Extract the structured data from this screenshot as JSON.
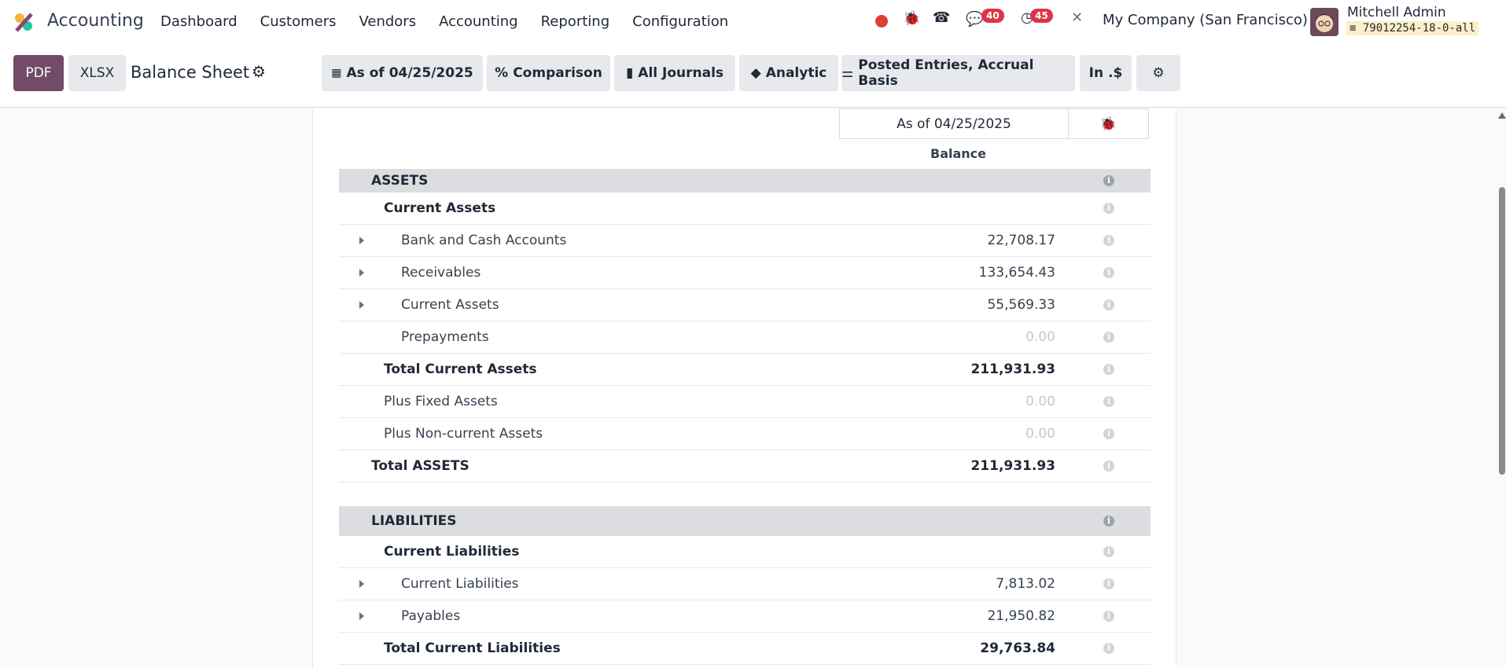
{
  "nav": {
    "app": "Accounting",
    "menu": [
      "Dashboard",
      "Customers",
      "Vendors",
      "Accounting",
      "Reporting",
      "Configuration"
    ],
    "messages_count": "40",
    "activities_count": "45",
    "company": "My Company (San Francisco)",
    "user": "Mitchell Admin",
    "database": "79012254-18-0-all"
  },
  "toolbar": {
    "pdf": "PDF",
    "xlsx": "XLSX",
    "title": "Balance Sheet",
    "filters": [
      {
        "icon": "calendar-icon",
        "glyph": "📅",
        "label": "As of 04/25/2025"
      },
      {
        "icon": "percent-icon",
        "glyph": "%",
        "label": "Comparison"
      },
      {
        "icon": "book-icon",
        "glyph": "▮",
        "label": "All Journals"
      },
      {
        "icon": "layers-icon",
        "glyph": "◆",
        "label": "Analytic"
      },
      {
        "icon": "sliders-icon",
        "glyph": "⚌",
        "label": "Posted Entries, Accrual Basis"
      },
      {
        "icon": "",
        "glyph": "",
        "label": "In .$"
      },
      {
        "icon": "gears-icon",
        "glyph": "⚙",
        "label": ""
      }
    ]
  },
  "report": {
    "column_header": "As of 04/25/2025",
    "column_label": "Balance",
    "rows": [
      {
        "type": "sec",
        "label": "ASSETS",
        "level": 0
      },
      {
        "type": "bold",
        "label": "Current Assets",
        "level": 1,
        "value": ""
      },
      {
        "label": "Bank and Cash Accounts",
        "level": 2,
        "value": "22,708.17",
        "expand": true
      },
      {
        "label": "Receivables",
        "level": 2,
        "value": "133,654.43",
        "expand": true
      },
      {
        "label": "Current Assets",
        "level": 2,
        "value": "55,569.33",
        "expand": true
      },
      {
        "label": "Prepayments",
        "level": 2,
        "value": "0.00",
        "muted": true
      },
      {
        "type": "bold",
        "label": "Total Current Assets",
        "level": 1,
        "value": "211,931.93"
      },
      {
        "label": "Plus Fixed Assets",
        "level": 1,
        "value": "0.00",
        "muted": true
      },
      {
        "label": "Plus Non-current Assets",
        "level": 1,
        "value": "0.00",
        "muted": true
      },
      {
        "type": "bold",
        "label": "Total ASSETS",
        "level": 0,
        "value": "211,931.93"
      },
      {
        "type": "sec2",
        "label": "LIABILITIES",
        "level": 0
      },
      {
        "type": "bold",
        "label": "Current Liabilities",
        "level": 1,
        "value": ""
      },
      {
        "label": "Current Liabilities",
        "level": 2,
        "value": "7,813.02",
        "expand": true
      },
      {
        "label": "Payables",
        "level": 2,
        "value": "21,950.82",
        "expand": true
      },
      {
        "type": "bold",
        "label": "Total Current Liabilities",
        "level": 1,
        "value": "29,763.84"
      }
    ]
  }
}
